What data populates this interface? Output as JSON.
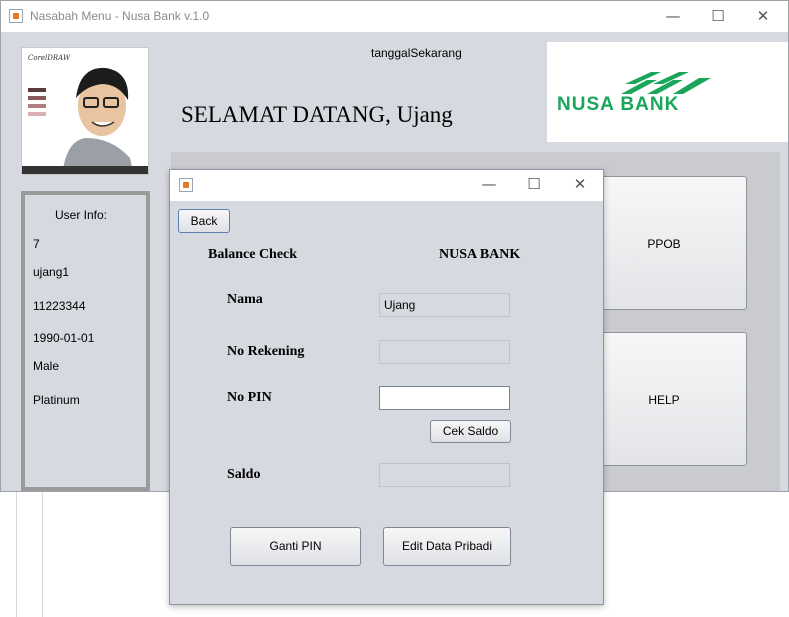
{
  "main_window": {
    "title": "Nasabah Menu - Nusa Bank v.1.0",
    "controls": {
      "minimize": "—",
      "maximize": "☐",
      "close": "✕"
    },
    "tanggal": "tanggalSekarang",
    "welcome": "SELAMAT DATANG, Ujang",
    "logo_text": "NUSA BANK",
    "photo_caption": "CorelDRAW",
    "user_info": {
      "title": "User Info:",
      "id": "7",
      "username": "ujang1",
      "account": "11223344",
      "birthdate": "1990-01-01",
      "gender": "Male",
      "tier": "Platinum"
    },
    "buttons": {
      "ppob": "PPOB",
      "help": "HELP"
    }
  },
  "dialog": {
    "controls": {
      "minimize": "—",
      "maximize": "☐",
      "close": "✕"
    },
    "back_label": "Back",
    "heading": "Balance Check",
    "bank_name": "NUSA BANK",
    "nama_label": "Nama",
    "nama_value": "Ujang",
    "rekening_label": "No Rekening",
    "rekening_value": "",
    "pin_label": "No PIN",
    "pin_value": "",
    "cek_saldo_label": "Cek Saldo",
    "saldo_label": "Saldo",
    "saldo_value": "",
    "ganti_pin_label": "Ganti PIN",
    "edit_data_label": "Edit Data Pribadi"
  },
  "colors": {
    "accent_green": "#1aa65a",
    "window_bg": "#d6d9df"
  }
}
